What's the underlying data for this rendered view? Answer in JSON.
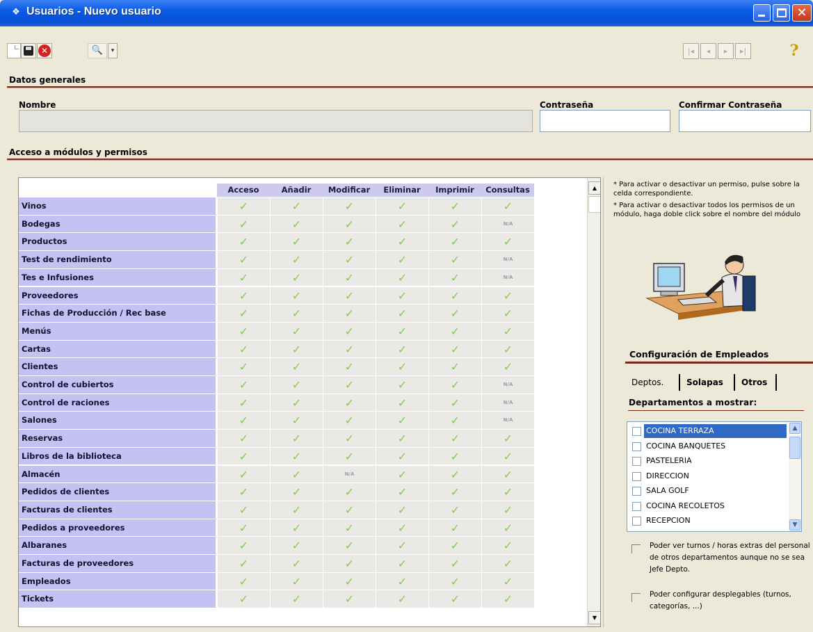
{
  "window": {
    "title": "Usuarios - Nuevo usuario",
    "title_icon": "app-icon",
    "buttons": {
      "minimize": "minimize-icon",
      "maximize": "maximize-icon",
      "close": "✕"
    }
  },
  "toolbar": {
    "new_icon": "new-document-icon",
    "save_icon": "save-disk-icon",
    "cancel_icon": "✕",
    "find_icon": "🔍",
    "find_dropdown": "▾",
    "nav_first": "|◂",
    "nav_prev": "◂",
    "nav_next": "▸",
    "nav_last": "▸|",
    "help": "?"
  },
  "sections": {
    "general": "Datos generales",
    "access": "Acceso a módulos y permisos"
  },
  "fields": {
    "nombre_label": "Nombre",
    "nombre_value": "",
    "contrasena_label": "Contraseña",
    "contrasena_value": "",
    "confirmar_label": "Confirmar Contraseña",
    "confirmar_value": ""
  },
  "grid": {
    "columns": [
      "Acceso",
      "Añadir",
      "Modificar",
      "Eliminar",
      "Imprimir",
      "Consultas"
    ],
    "check": "✓",
    "na": "N/A",
    "rows": [
      {
        "name": "Vinos",
        "cells": [
          "✓",
          "✓",
          "✓",
          "✓",
          "✓",
          "✓"
        ]
      },
      {
        "name": "Bodegas",
        "cells": [
          "✓",
          "✓",
          "✓",
          "✓",
          "✓",
          "N/A"
        ]
      },
      {
        "name": "Productos",
        "cells": [
          "✓",
          "✓",
          "✓",
          "✓",
          "✓",
          "✓"
        ]
      },
      {
        "name": "Test de rendimiento",
        "cells": [
          "✓",
          "✓",
          "✓",
          "✓",
          "✓",
          "N/A"
        ]
      },
      {
        "name": "Tes e Infusiones",
        "cells": [
          "✓",
          "✓",
          "✓",
          "✓",
          "✓",
          "N/A"
        ]
      },
      {
        "name": "Proveedores",
        "cells": [
          "✓",
          "✓",
          "✓",
          "✓",
          "✓",
          "✓"
        ]
      },
      {
        "name": "Fichas de Producción / Rec base",
        "cells": [
          "✓",
          "✓",
          "✓",
          "✓",
          "✓",
          "✓"
        ]
      },
      {
        "name": "Menús",
        "cells": [
          "✓",
          "✓",
          "✓",
          "✓",
          "✓",
          "✓"
        ]
      },
      {
        "name": "Cartas",
        "cells": [
          "✓",
          "✓",
          "✓",
          "✓",
          "✓",
          "✓"
        ]
      },
      {
        "name": "Clientes",
        "cells": [
          "✓",
          "✓",
          "✓",
          "✓",
          "✓",
          "✓"
        ]
      },
      {
        "name": "Control de cubiertos",
        "cells": [
          "✓",
          "✓",
          "✓",
          "✓",
          "✓",
          "N/A"
        ]
      },
      {
        "name": "Control de raciones",
        "cells": [
          "✓",
          "✓",
          "✓",
          "✓",
          "✓",
          "N/A"
        ]
      },
      {
        "name": "Salones",
        "cells": [
          "✓",
          "✓",
          "✓",
          "✓",
          "✓",
          "N/A"
        ]
      },
      {
        "name": "Reservas",
        "cells": [
          "✓",
          "✓",
          "✓",
          "✓",
          "✓",
          "✓"
        ]
      },
      {
        "name": "Libros de la biblioteca",
        "cells": [
          "✓",
          "✓",
          "✓",
          "✓",
          "✓",
          "✓"
        ]
      },
      {
        "name": "Almacén",
        "cells": [
          "✓",
          "✓",
          "N/A",
          "✓",
          "✓",
          "✓"
        ]
      },
      {
        "name": "Pedidos de clientes",
        "cells": [
          "✓",
          "✓",
          "✓",
          "✓",
          "✓",
          "✓"
        ]
      },
      {
        "name": "Facturas de clientes",
        "cells": [
          "✓",
          "✓",
          "✓",
          "✓",
          "✓",
          "✓"
        ]
      },
      {
        "name": "Pedidos a proveedores",
        "cells": [
          "✓",
          "✓",
          "✓",
          "✓",
          "✓",
          "✓"
        ]
      },
      {
        "name": "Albaranes",
        "cells": [
          "✓",
          "✓",
          "✓",
          "✓",
          "✓",
          "✓"
        ]
      },
      {
        "name": "Facturas de proveedores",
        "cells": [
          "✓",
          "✓",
          "✓",
          "✓",
          "✓",
          "✓"
        ]
      },
      {
        "name": "Empleados",
        "cells": [
          "✓",
          "✓",
          "✓",
          "✓",
          "✓",
          "✓"
        ]
      },
      {
        "name": "Tickets",
        "cells": [
          "✓",
          "✓",
          "✓",
          "✓",
          "✓",
          "✓"
        ]
      }
    ],
    "scroll_up": "▲",
    "scroll_down": "▼"
  },
  "side": {
    "hint1": "* Para activar o desactivar un permiso, pulse sobre la celda correspondiente.",
    "hint2": "* Para activar o desactivar todos los permisos de un módulo, haga doble click sobre el nombre del módulo",
    "illustration": "person-at-computer-icon",
    "emp_title": "Configuración de Empleados",
    "tabs": [
      "Deptos.",
      "Solapas",
      "Otros"
    ],
    "dept_title": "Departamentos a mostrar:",
    "departments": [
      {
        "name": "COCINA TERRAZA",
        "selected": true
      },
      {
        "name": "COCINA BANQUETES",
        "selected": false
      },
      {
        "name": "PASTELERIA",
        "selected": false
      },
      {
        "name": "DIRECCION",
        "selected": false
      },
      {
        "name": "SALA GOLF",
        "selected": false
      },
      {
        "name": "COCINA RECOLETOS",
        "selected": false
      },
      {
        "name": "RECEPCION",
        "selected": false
      }
    ],
    "list_up": "▲",
    "list_down": "▼",
    "option1": "Poder ver turnos / horas extras del personal de otros departamentos aunque no se sea Jefe Depto.",
    "option2": "Poder configurar desplegables (turnos, categorías, ...)"
  },
  "colors": {
    "titlebar": "#0a5ce6",
    "row_header": "#c4c2f2",
    "check": "#7fce45",
    "section_rule": "#7b2a1a",
    "selection": "#316ac5"
  }
}
